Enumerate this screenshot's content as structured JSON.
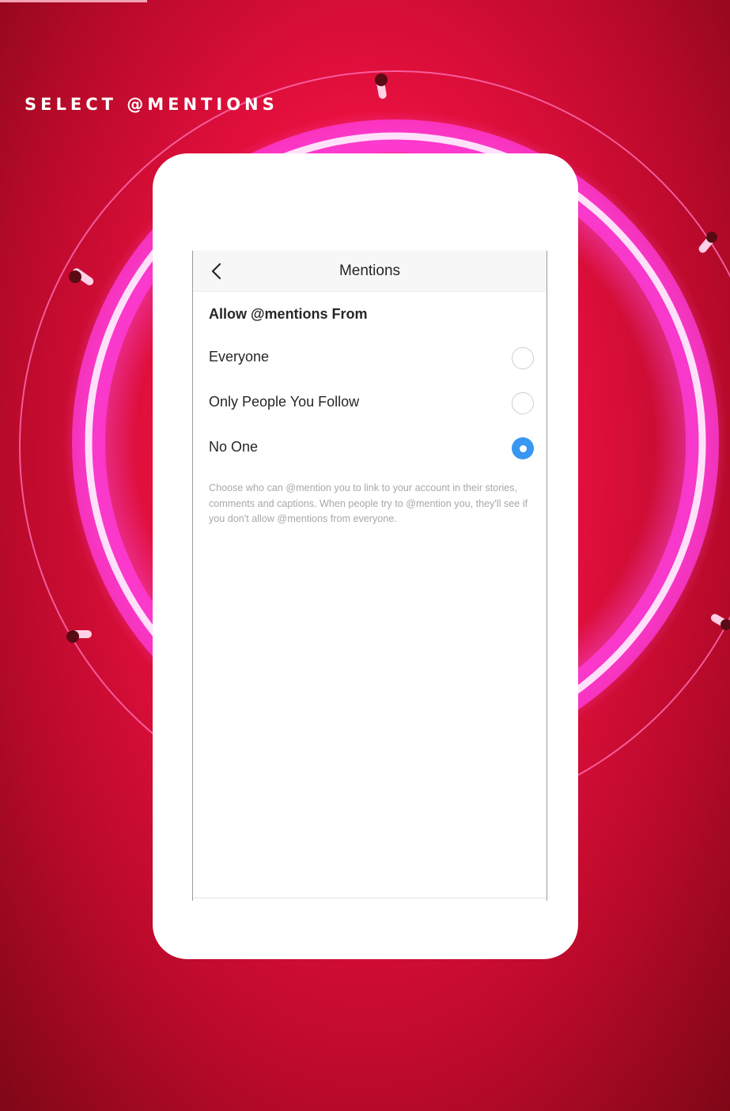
{
  "caption": "SELECT @MENTIONS",
  "screen": {
    "title": "Mentions",
    "section_header": "Allow @mentions From",
    "options": [
      {
        "label": "Everyone",
        "selected": false
      },
      {
        "label": "Only People You Follow",
        "selected": false
      },
      {
        "label": "No One",
        "selected": true
      }
    ],
    "help_text": "Choose who can @mention you to link to your account in their stories, comments and captions. When people try to @mention you, they'll see if you don't allow @mentions from everyone."
  },
  "icons": {
    "back": "chevron-left-icon",
    "radio_selected": "radio-selected-icon",
    "radio_unselected": "radio-unselected-icon"
  },
  "colors": {
    "accent": "#3897f0",
    "background_red": "#e8103f",
    "neon_pink": "#ff40d8"
  }
}
